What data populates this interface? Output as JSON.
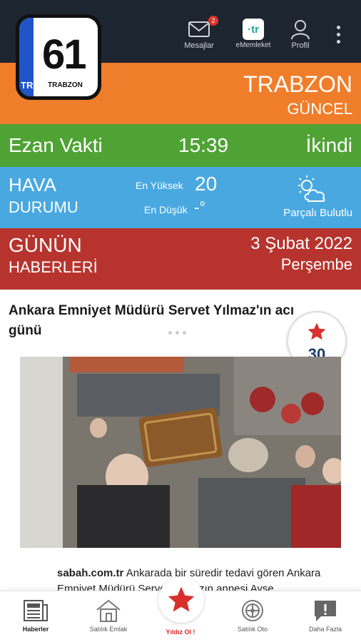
{
  "logo": {
    "plate_code": "TR",
    "number": "61",
    "city": "TRABZON"
  },
  "topbar": {
    "messages_label": "Mesajlar",
    "messages_badge": "2",
    "ememleket_label": "eMemleket",
    "profile_label": "Profil"
  },
  "city_band": {
    "title": "TRABZON",
    "subtitle": "GÜNCEL",
    "color": "#f07d2a"
  },
  "prayer": {
    "label": "Ezan Vakti",
    "time": "15:39",
    "name": "İkindi",
    "color": "#4fa335"
  },
  "weather": {
    "label_line1": "HAVA",
    "label_line2": "DURUMU",
    "high_label": "En Yüksek",
    "high_value": "20",
    "low_label": "En Düşük",
    "low_value": "-°",
    "condition": "Parçalı Bulutlu",
    "icon": "partly-cloudy-icon",
    "color": "#49a8e0"
  },
  "news_band": {
    "label_line1": "GÜNÜN",
    "label_line2": "HABERLERİ",
    "date": "3 Şubat 2022",
    "weekday": "Perşembe",
    "color": "#b7342e"
  },
  "article": {
    "title": "Ankara Emniyet Müdürü Servet Yılmaz'ın acı günü",
    "star_count": "30",
    "source": "sabah.com.tr",
    "snippet": "Ankarada bir süredir tedavi gören Ankara Emniyet Müdürü Servet Yılmazın annesi Ayşe"
  },
  "bottom_nav": {
    "items": [
      {
        "label": "Haberler",
        "icon": "newspaper-icon"
      },
      {
        "label": "Satılık Emlak",
        "icon": "house-icon"
      },
      {
        "label": "Yıldız Ol !",
        "icon": "star-icon"
      },
      {
        "label": "Satılık Oto",
        "icon": "wheel-icon"
      },
      {
        "label": "Daha Fazla",
        "icon": "more-chat-icon"
      }
    ]
  }
}
